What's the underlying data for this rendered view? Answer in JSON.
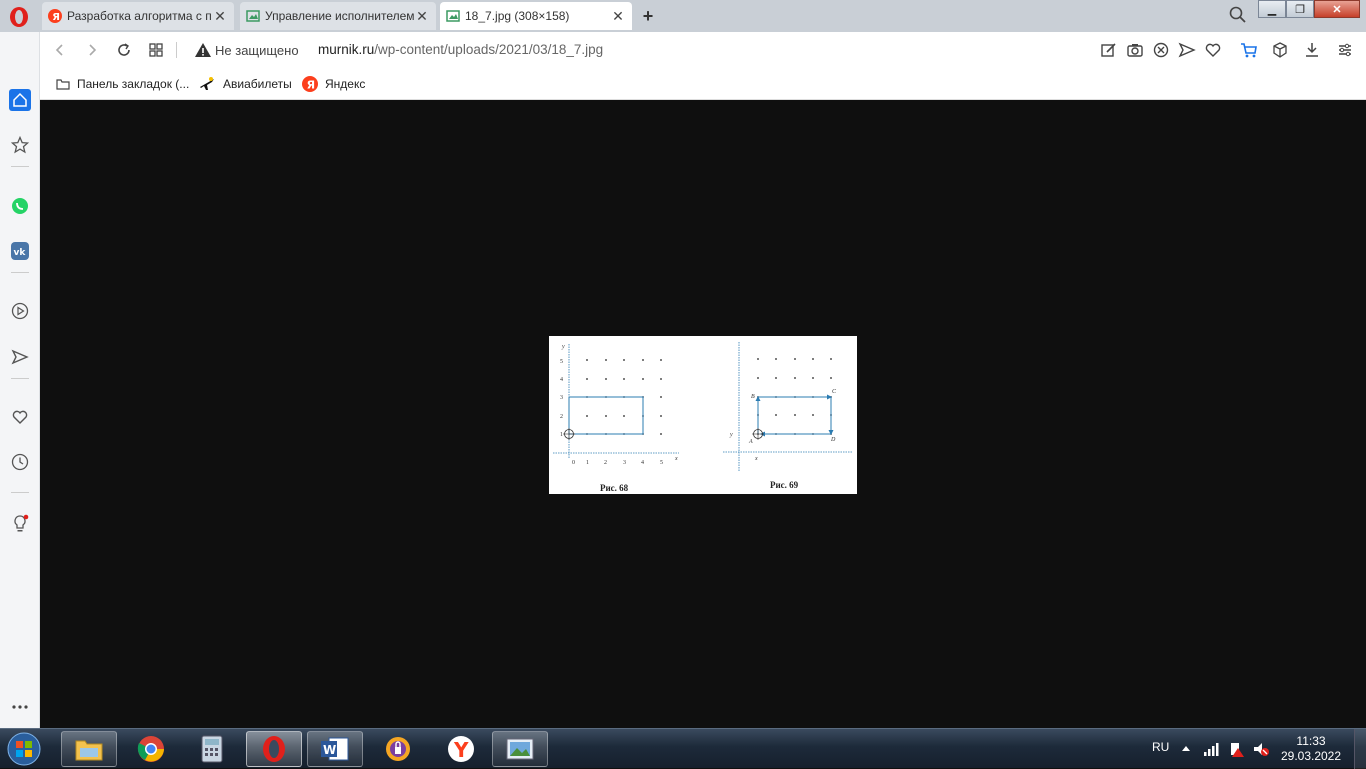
{
  "browser": {
    "tabs": [
      {
        "title": "Разработка алгоритма с п",
        "icon": "yandex-icon",
        "active": false
      },
      {
        "title": "Управление исполнителем",
        "icon": "image-tab-icon",
        "active": false
      },
      {
        "title": "18_7.jpg (308×158)",
        "icon": "image-tab-icon",
        "active": true
      }
    ],
    "new_tab_label": "+",
    "close_label": "✕",
    "address": {
      "security_text": "Не защищено",
      "url_host": "murnik.ru",
      "url_path": "/wp-content/uploads/2021/03/18_7.jpg"
    },
    "bookmarks": [
      {
        "label": "Панель закладок (...",
        "icon": "folder-icon"
      },
      {
        "label": "Авиабилеты",
        "icon": "airplane-icon"
      },
      {
        "label": "Яндекс",
        "icon": "yandex-icon"
      }
    ]
  },
  "image": {
    "fig68": {
      "caption": "Рис. 68",
      "x_label": "x",
      "y_label": "y",
      "x_ticks": [
        "0",
        "1",
        "2",
        "3",
        "4",
        "5"
      ],
      "y_ticks": [
        "1",
        "2",
        "3",
        "4",
        "5"
      ]
    },
    "fig69": {
      "caption": "Рис. 69",
      "corner_labels": [
        "A",
        "B",
        "C",
        "D"
      ],
      "x_mark": "x",
      "y_mark": "y"
    }
  },
  "taskbar": {
    "language": "RU",
    "time": "11:33",
    "date": "29.03.2022"
  },
  "colors": {
    "accent": "#1a73e8",
    "opera_red": "#e0201b",
    "figure_blue": "#2b7cb2"
  }
}
